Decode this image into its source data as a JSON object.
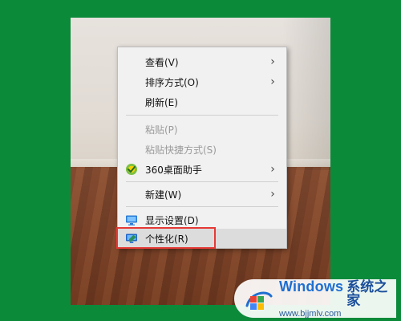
{
  "desktop": {
    "background": "wall-and-wood-floor-photo"
  },
  "context_menu": {
    "items": [
      {
        "label": "查看(V)",
        "enabled": true,
        "has_submenu": true
      },
      {
        "label": "排序方式(O)",
        "enabled": true,
        "has_submenu": true
      },
      {
        "label": "刷新(E)",
        "enabled": true,
        "has_submenu": false
      },
      {
        "label": "粘贴(P)",
        "enabled": false,
        "has_submenu": false
      },
      {
        "label": "粘贴快捷方式(S)",
        "enabled": false,
        "has_submenu": false
      },
      {
        "label": "360桌面助手",
        "enabled": true,
        "has_submenu": true,
        "icon": "360-assistant-icon"
      },
      {
        "label": "新建(W)",
        "enabled": true,
        "has_submenu": true
      },
      {
        "label": "显示设置(D)",
        "enabled": true,
        "has_submenu": false,
        "icon": "display-settings-icon"
      },
      {
        "label": "个性化(R)",
        "enabled": true,
        "has_submenu": false,
        "icon": "personalize-icon",
        "highlighted": true
      }
    ],
    "chevron_glyph": "›"
  },
  "watermark": {
    "brand": "Windows",
    "brand_cn": "系统之家",
    "url": "www.bjjmlv.com"
  },
  "colors": {
    "frame_green": "#0b8a3a",
    "highlight_red": "#e53935",
    "menu_bg": "#f1f1f1",
    "hover_bg": "#dcdcdc",
    "disabled_text": "#9a9a9a",
    "watermark_blue": "#1f6fd1"
  }
}
